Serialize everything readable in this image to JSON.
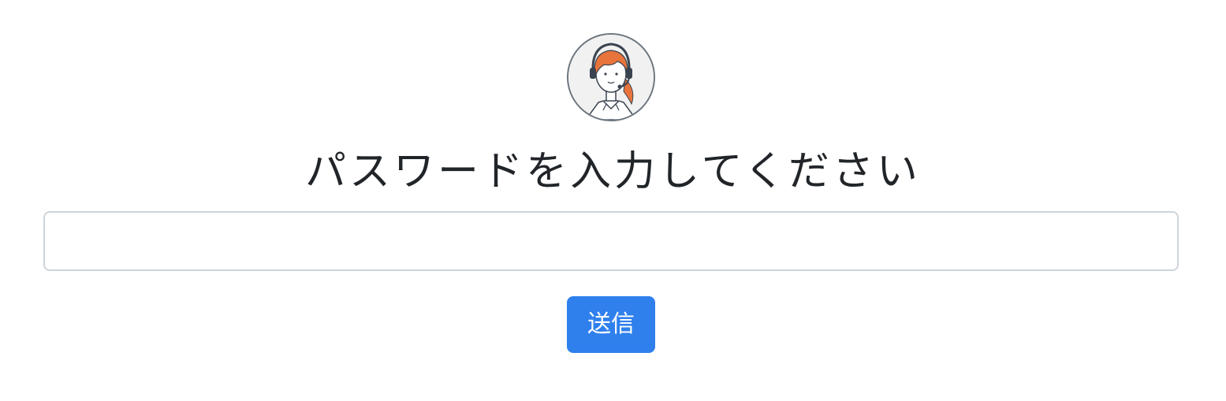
{
  "avatar": {
    "icon": "support-operator-avatar",
    "hair_color": "#e8743b",
    "border_color": "#6c757d"
  },
  "form": {
    "heading": "パスワードを入力してください",
    "password_value": "",
    "password_placeholder": "",
    "submit_label": "送信"
  },
  "colors": {
    "button_bg": "#2f80ed",
    "button_text": "#ffffff",
    "input_border": "#ced4da",
    "text": "#212529"
  }
}
